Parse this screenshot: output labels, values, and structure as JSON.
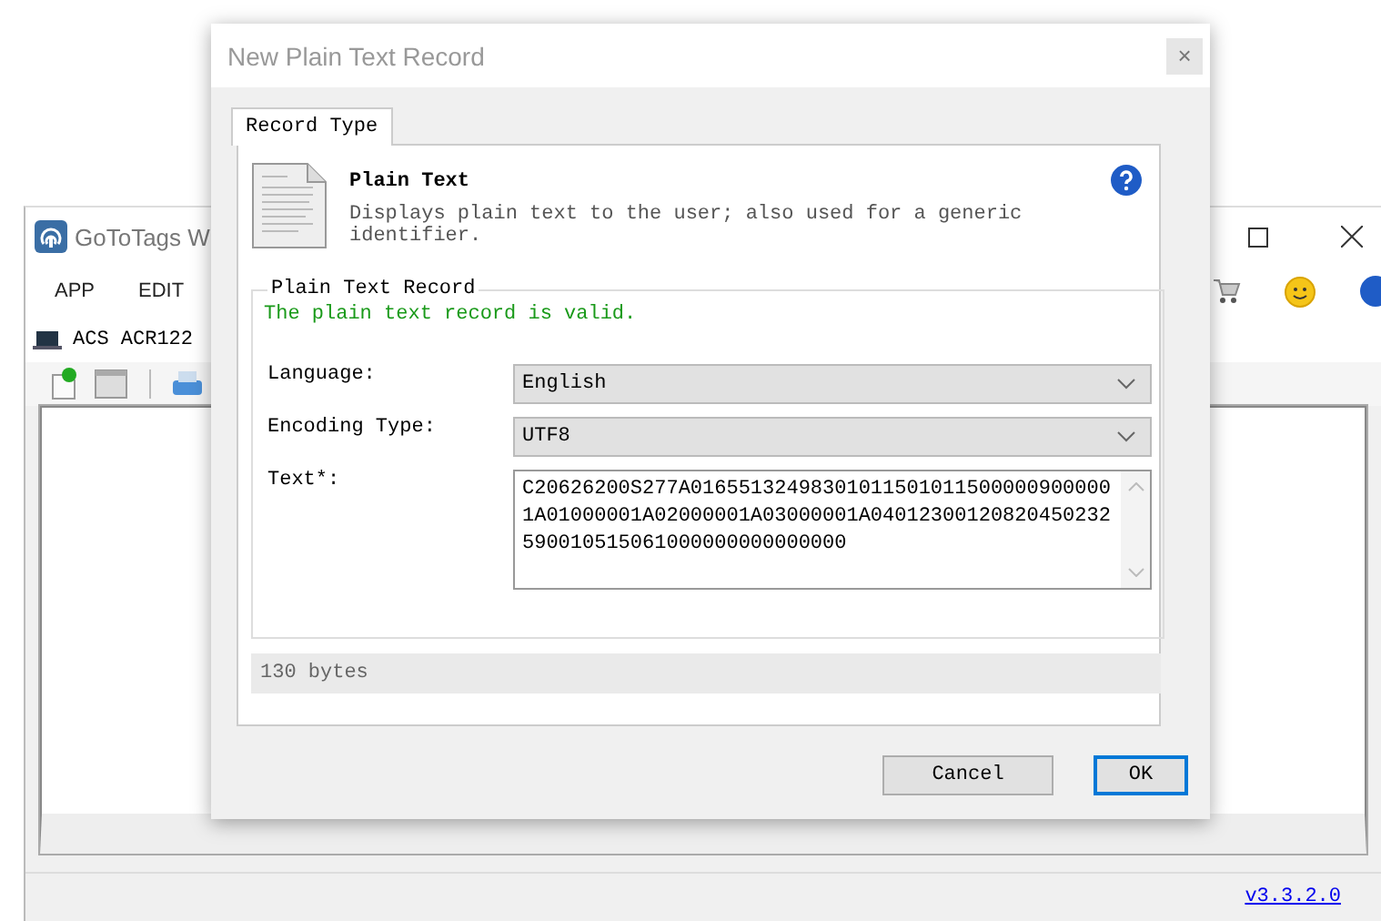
{
  "main_window": {
    "title": "GoToTags W",
    "menu": [
      "APP",
      "EDIT"
    ],
    "reader": "ACS ACR122",
    "version": "v3.3.2.0"
  },
  "dialog": {
    "title": "New Plain Text Record",
    "close": "×",
    "tabs": [
      {
        "label": "Record Type",
        "selected": true
      }
    ],
    "record": {
      "name": "Plain Text",
      "description": "Displays plain text to the user; also used for a generic identifier."
    },
    "group": {
      "legend": "Plain Text Record",
      "status": "The plain text record is valid.",
      "fields": [
        {
          "kind": "select",
          "label": "Language:",
          "value": "English"
        },
        {
          "kind": "select",
          "label": "Encoding Type:",
          "value": "UTF8"
        },
        {
          "kind": "textarea",
          "label": "Text*:",
          "value": "C20626200S277A01655132498301011501011500000900000 1A01000001A02000001A03000001A04012300120820450232590010515061000000000000000"
        }
      ]
    },
    "size": "130 bytes",
    "buttons": [
      {
        "label": "Cancel",
        "default": false
      },
      {
        "label": "OK",
        "default": true
      }
    ]
  }
}
